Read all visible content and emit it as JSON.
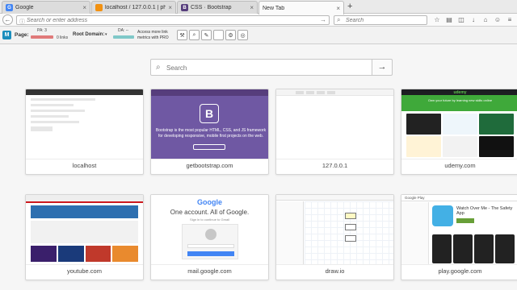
{
  "tabs": [
    {
      "title": "Google",
      "favicon_color": "#4285f4",
      "favicon_letter": "G",
      "active": false
    },
    {
      "title": "localhost / 127.0.0.1 | php...",
      "favicon_color": "#f29111",
      "favicon_letter": "",
      "active": false
    },
    {
      "title": "CSS · Bootstrap",
      "favicon_color": "#563d7c",
      "favicon_letter": "B",
      "active": false
    },
    {
      "title": "New Tab",
      "favicon_color": "",
      "favicon_letter": "",
      "active": true
    }
  ],
  "new_tab_symbol": "+",
  "nav": {
    "url_placeholder": "Search or enter address",
    "search_placeholder": "Search"
  },
  "mozbar": {
    "logo_letter": "M",
    "page_label": "Page:",
    "pa_label": "PA: 3",
    "links_label": "0 links",
    "root_domain_label": "Root Domain:",
    "da_label": "DA: --",
    "access_text": "Access more link metrics with PRO"
  },
  "content": {
    "search_placeholder": "Search",
    "search_go": "→"
  },
  "tiles": [
    {
      "label": "localhost"
    },
    {
      "label": "getbootstrap.com"
    },
    {
      "label": "127.0.0.1"
    },
    {
      "label": "udemy.com"
    },
    {
      "label": "youtube.com"
    },
    {
      "label": "mail.google.com"
    },
    {
      "label": "draw.io"
    },
    {
      "label": "play.google.com"
    }
  ],
  "thumb_text": {
    "bootstrap_logo": "B",
    "bootstrap_tagline": "Bootstrap is the most popular HTML, CSS, and JS framework for developing responsive, mobile first projects on the web.",
    "udemy_brand": "udemy",
    "udemy_banner": "Own your future by learning new skills online",
    "google_logo": "Google",
    "google_title": "One account. All of Google.",
    "google_sub": "Sign in to continue to Gmail",
    "gplay_brand": "Google Play",
    "gplay_title": "Watch Over Me - The Safety App"
  },
  "colors": {
    "bootstrap_purple": "#563d7c",
    "udemy_green": "#3fa93a",
    "google_blue": "#4285f4",
    "youtube_red": "#cc181e",
    "gplay_green": "#689f38"
  }
}
